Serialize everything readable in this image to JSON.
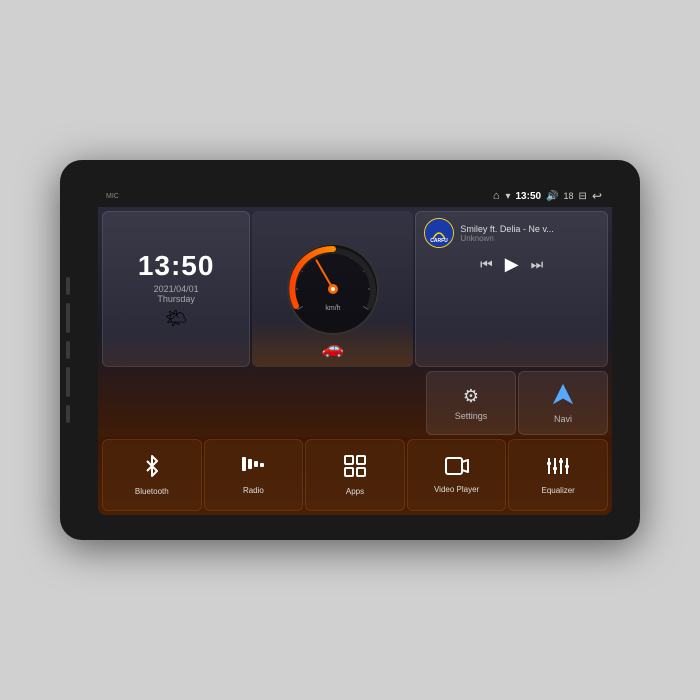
{
  "device": {
    "background": "#1a1a1a"
  },
  "statusBar": {
    "mic": "MIC",
    "home": "⌂",
    "wifi": "▾",
    "time": "13:50",
    "volume": "🔊",
    "vol_number": "18",
    "screen": "⊟",
    "back": "↩"
  },
  "clock": {
    "time": "13:50",
    "date": "2021/04/01",
    "day": "Thursday",
    "weather": "🌤"
  },
  "media": {
    "logo": "CARFU",
    "title": "Smiley ft. Delia - Ne v...",
    "artist": "Unknown",
    "prev": "⏮",
    "play": "▶",
    "next": "⏭"
  },
  "settings": [
    {
      "id": "settings",
      "icon": "⚙",
      "label": "Settings"
    },
    {
      "id": "navi",
      "icon": "◬",
      "label": "Navi"
    }
  ],
  "apps": [
    {
      "id": "bluetooth",
      "icon": "bluetooth",
      "label": "Bluetooth"
    },
    {
      "id": "radio",
      "icon": "radio",
      "label": "Radio"
    },
    {
      "id": "apps",
      "icon": "apps",
      "label": "Apps"
    },
    {
      "id": "video-player",
      "icon": "video",
      "label": "Video Player"
    },
    {
      "id": "equalizer",
      "icon": "equalizer",
      "label": "Equalizer"
    }
  ],
  "speedo": {
    "unit": "km/h"
  }
}
